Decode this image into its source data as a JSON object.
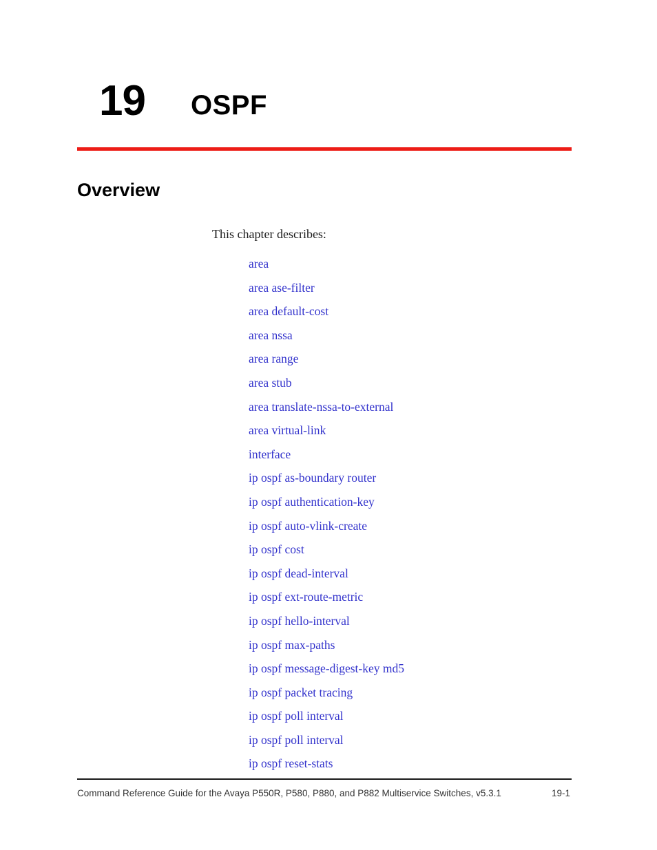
{
  "page": {
    "background_color": "#FFFFFF",
    "accent_rule_color": "#ED1C16",
    "link_color": "#3333CC",
    "footer_rule_color": "#1A1A1A"
  },
  "chapter": {
    "number": "19",
    "title": "OSPF"
  },
  "section": {
    "heading": "Overview",
    "intro": "This chapter describes:"
  },
  "xref_list": [
    {
      "label": "area"
    },
    {
      "label": "area ase-filter"
    },
    {
      "label": "area default-cost"
    },
    {
      "label": "area nssa"
    },
    {
      "label": "area range"
    },
    {
      "label": "area stub"
    },
    {
      "label": "area translate-nssa-to-external"
    },
    {
      "label": "area virtual-link"
    },
    {
      "label": "interface"
    },
    {
      "label": "ip ospf as-boundary router"
    },
    {
      "label": "ip ospf authentication-key"
    },
    {
      "label": "ip ospf auto-vlink-create"
    },
    {
      "label": "ip ospf cost"
    },
    {
      "label": "ip ospf dead-interval"
    },
    {
      "label": "ip ospf ext-route-metric"
    },
    {
      "label": "ip ospf hello-interval"
    },
    {
      "label": "ip ospf max-paths"
    },
    {
      "label": "ip ospf message-digest-key md5"
    },
    {
      "label": "ip ospf packet tracing"
    },
    {
      "label": "ip ospf poll interval"
    },
    {
      "label": "ip ospf poll interval"
    },
    {
      "label": "ip ospf reset-stats"
    }
  ],
  "footer": {
    "title": "Command Reference Guide for the Avaya P550R, P580, P880, and P882 Multiservice Switches, v5.3.1",
    "page_number": "19-1"
  }
}
